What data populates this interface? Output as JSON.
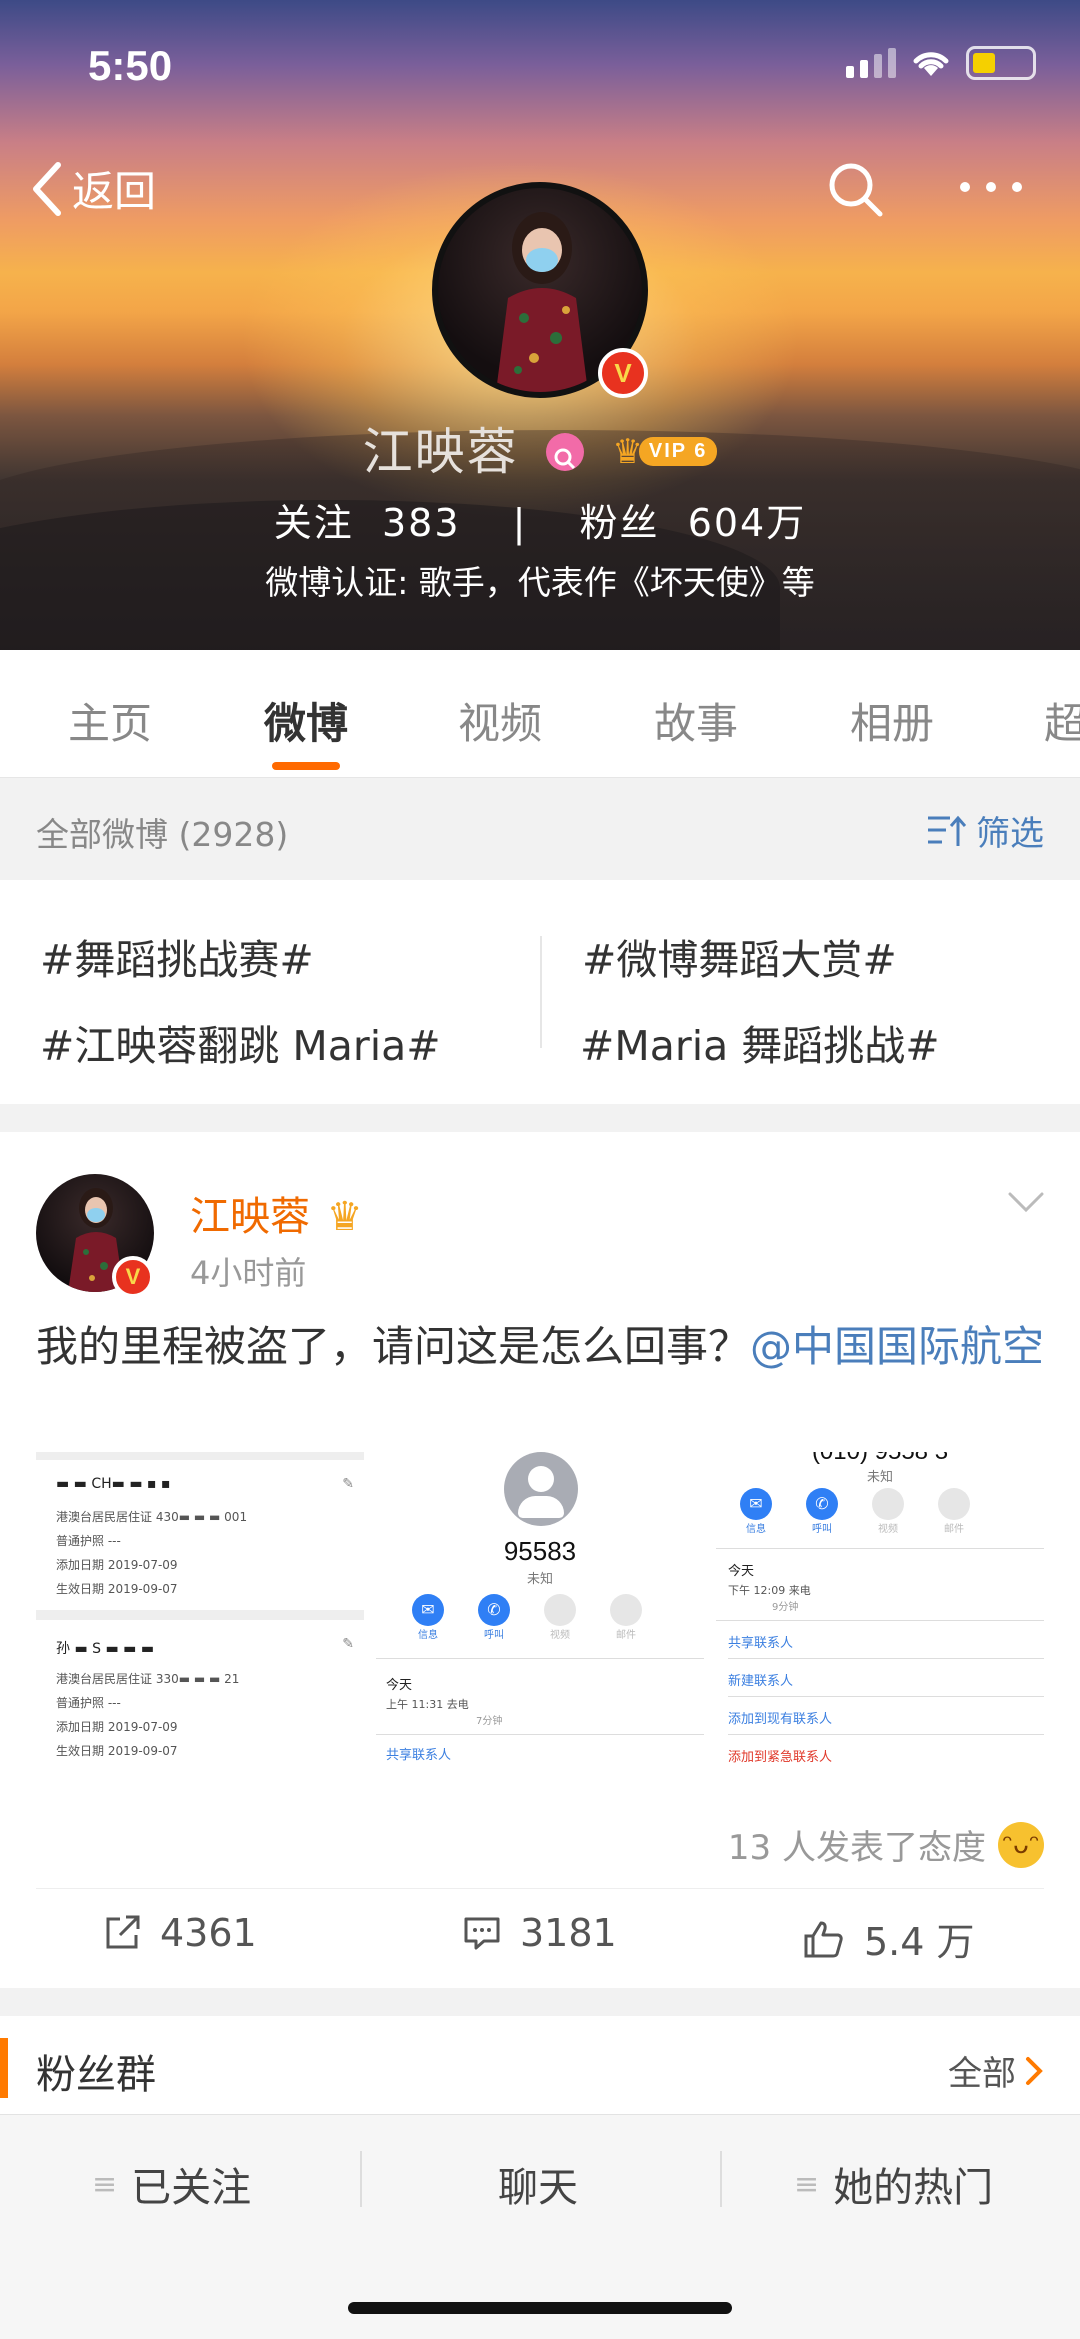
{
  "status_bar": {
    "time": "5:50"
  },
  "header": {
    "back_label": "返回",
    "name": "江映蓉",
    "vip_label": "VIP 6",
    "stats": {
      "following_label": "关注",
      "following": "383",
      "separator": "|",
      "fans_label": "粉丝",
      "fans": "604万"
    },
    "verification": "微博认证: 歌手，代表作《坏天使》等"
  },
  "tabs": [
    {
      "label": "主页"
    },
    {
      "label": "微博"
    },
    {
      "label": "视频"
    },
    {
      "label": "故事"
    },
    {
      "label": "相册"
    },
    {
      "label": "超"
    }
  ],
  "filter_bar": {
    "count_text": "全部微博 (2928)",
    "filter_label": "筛选"
  },
  "topics": [
    "#舞蹈挑战赛#",
    "#微博舞蹈大赏#",
    "#江映蓉翻跳 Maria#",
    "#Maria 舞蹈挑战#"
  ],
  "post": {
    "author": "江映蓉",
    "time": "4小时前",
    "text": "我的里程被盗了，请问这是怎么回事？",
    "mention": "@中国国际航空",
    "images": {
      "img1": {
        "row1_name": "▬ ▬ CH▬ ▬ ▪ ▪",
        "row1_id": "港澳台居民居住证  430▬ ▬ ▬ 001",
        "row1_passport": "普通护照   ---",
        "row1_added": "添加日期   2019-07-09",
        "row1_valid": "生效日期   2019-09-07",
        "row2_name": "孙 ▬ S ▬ ▬ ▬",
        "row2_id": "港澳台居民居住证  330▬ ▬ ▬ 21",
        "row2_passport": "普通护照   ---",
        "row2_added": "添加日期   2019-07-09",
        "row2_valid": "生效日期   2019-09-07"
      },
      "img2": {
        "number": "95583",
        "status": "未知",
        "btn_msg": "信息",
        "btn_call": "呼叫",
        "btn_video": "视频",
        "btn_mail": "邮件",
        "today": "今天",
        "call_time": "上午 11:31   去电",
        "duration": "7分钟",
        "share": "共享联系人"
      },
      "img3": {
        "number": "(010) 9558 3",
        "status": "未知",
        "btn_msg": "信息",
        "btn_call": "呼叫",
        "btn_video": "视频",
        "btn_mail": "邮件",
        "today": "今天",
        "call_time": "下午 12:09   来电",
        "duration": "9分钟",
        "share": "共享联系人",
        "new_contact": "新建联系人",
        "add_existing": "添加到现有联系人",
        "add_emergency": "添加到紧急联系人"
      }
    },
    "reactions_text": "13 人发表了态度",
    "reposts": "4361",
    "comments": "3181",
    "likes": "5.4 万"
  },
  "fans_group": {
    "title": "粉丝群",
    "all_label": "全部"
  },
  "bottom_bar": {
    "follow": "已关注",
    "chat": "聊天",
    "hot": "她的热门"
  },
  "colors": {
    "accent": "#ff6a00",
    "link": "#4a7ebb",
    "author": "#f06a00"
  }
}
